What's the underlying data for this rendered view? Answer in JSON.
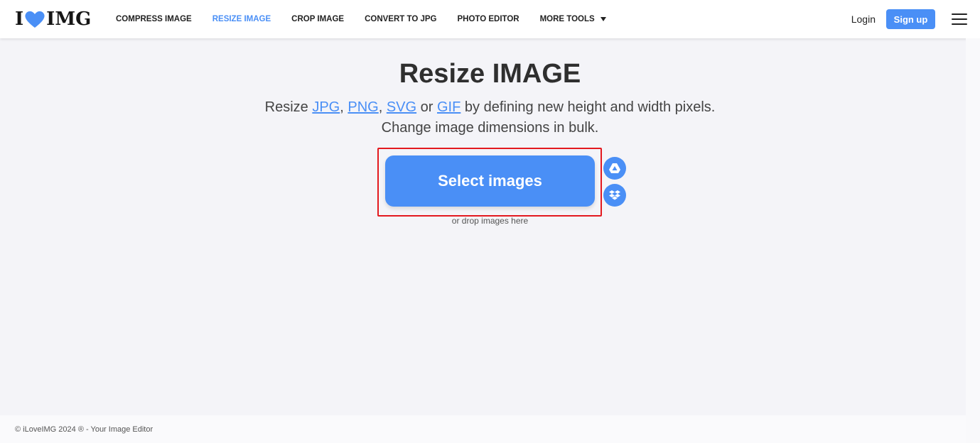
{
  "header": {
    "logo": {
      "left": "I",
      "right": "IMG"
    },
    "nav": [
      {
        "label": "COMPRESS IMAGE",
        "active": false
      },
      {
        "label": "RESIZE IMAGE",
        "active": true
      },
      {
        "label": "CROP IMAGE",
        "active": false
      },
      {
        "label": "CONVERT TO JPG",
        "active": false
      },
      {
        "label": "PHOTO EDITOR",
        "active": false
      },
      {
        "label": "MORE TOOLS",
        "active": false
      }
    ],
    "login_label": "Login",
    "signup_label": "Sign up"
  },
  "main": {
    "title": "Resize IMAGE",
    "subtitle": {
      "prefix": "Resize ",
      "formats": [
        "JPG",
        "PNG",
        "SVG",
        "GIF"
      ],
      "sep1": ", ",
      "sep2": ", ",
      "sep3": " or ",
      "suffix": " by defining new height and width pixels.",
      "line2": "Change image dimensions in bulk."
    },
    "select_button_label": "Select images",
    "drop_text": "or drop images here",
    "cloud_icons": [
      "google-drive-icon",
      "dropbox-icon"
    ]
  },
  "footer": {
    "text": "© iLoveIMG 2024 ® - Your Image Editor"
  },
  "colors": {
    "accent": "#4a8ff6",
    "highlight": "#e3191f",
    "background": "#f4f4f8"
  }
}
